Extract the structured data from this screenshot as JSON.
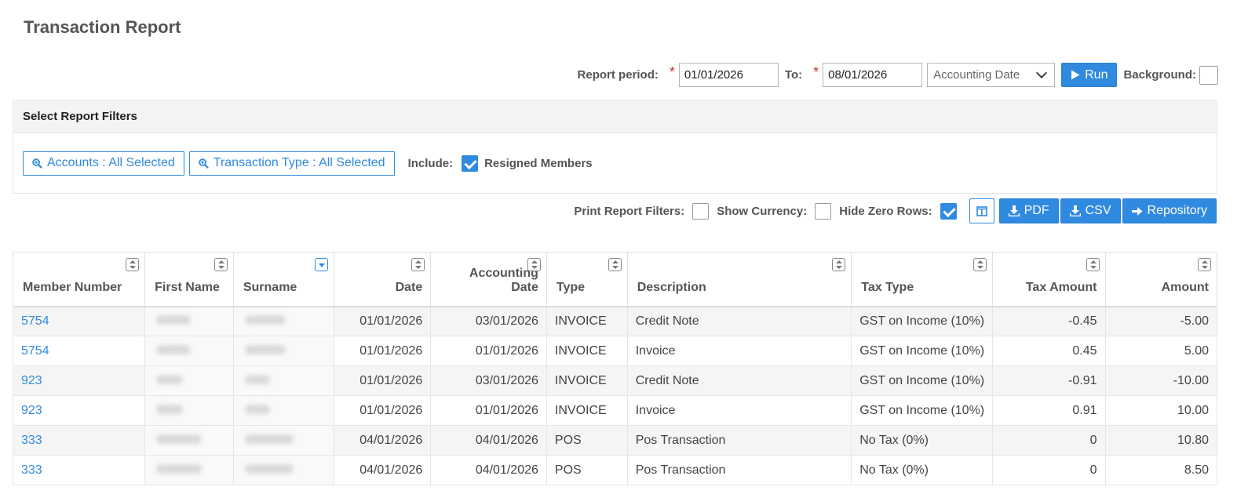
{
  "page": {
    "title": "Transaction Report"
  },
  "period": {
    "label": "Report period:",
    "from": "01/01/2026",
    "to_label": "To:",
    "to": "08/01/2026",
    "date_type": "Accounting Date",
    "run_label": "Run",
    "background_label": "Background:",
    "background_checked": false
  },
  "filters": {
    "header": "Select Report Filters",
    "accounts_label": "Accounts : All Selected",
    "transaction_type_label": "Transaction Type : All Selected",
    "include_label": "Include:",
    "resigned_label": "Resigned Members",
    "resigned_checked": true
  },
  "options": {
    "print_filters_label": "Print Report Filters:",
    "print_filters_checked": false,
    "show_currency_label": "Show Currency:",
    "show_currency_checked": false,
    "hide_zero_label": "Hide Zero Rows:",
    "hide_zero_checked": true,
    "pdf_label": "PDF",
    "csv_label": "CSV",
    "repository_label": "Repository"
  },
  "table": {
    "columns": [
      "Member Number",
      "First Name",
      "Surname",
      "Date",
      "Accounting Date",
      "Type",
      "Description",
      "Tax Type",
      "Tax Amount",
      "Amount"
    ],
    "sorted_column": "Surname",
    "rows": [
      {
        "member": "5754",
        "date": "01/01/2026",
        "acc_date": "03/01/2026",
        "type": "INVOICE",
        "description": "Credit Note",
        "tax_type": "GST on Income (10%)",
        "tax_amount": "-0.45",
        "amount": "-5.00"
      },
      {
        "member": "5754",
        "date": "01/01/2026",
        "acc_date": "01/01/2026",
        "type": "INVOICE",
        "description": "Invoice",
        "tax_type": "GST on Income (10%)",
        "tax_amount": "0.45",
        "amount": "5.00"
      },
      {
        "member": "923",
        "date": "01/01/2026",
        "acc_date": "03/01/2026",
        "type": "INVOICE",
        "description": "Credit Note",
        "tax_type": "GST on Income (10%)",
        "tax_amount": "-0.91",
        "amount": "-10.00"
      },
      {
        "member": "923",
        "date": "01/01/2026",
        "acc_date": "01/01/2026",
        "type": "INVOICE",
        "description": "Invoice",
        "tax_type": "GST on Income (10%)",
        "tax_amount": "0.91",
        "amount": "10.00"
      },
      {
        "member": "333",
        "date": "04/01/2026",
        "acc_date": "04/01/2026",
        "type": "POS",
        "description": "Pos Transaction",
        "tax_type": "No Tax (0%)",
        "tax_amount": "0",
        "amount": "10.80"
      },
      {
        "member": "333",
        "date": "04/01/2026",
        "acc_date": "04/01/2026",
        "type": "POS",
        "description": "Pos Transaction",
        "tax_type": "No Tax (0%)",
        "tax_amount": "0",
        "amount": "8.50"
      }
    ]
  },
  "colors": {
    "accent": "#2f8ae0",
    "required": "#c0392b",
    "filter_header_bg": "#f3f3f3"
  }
}
